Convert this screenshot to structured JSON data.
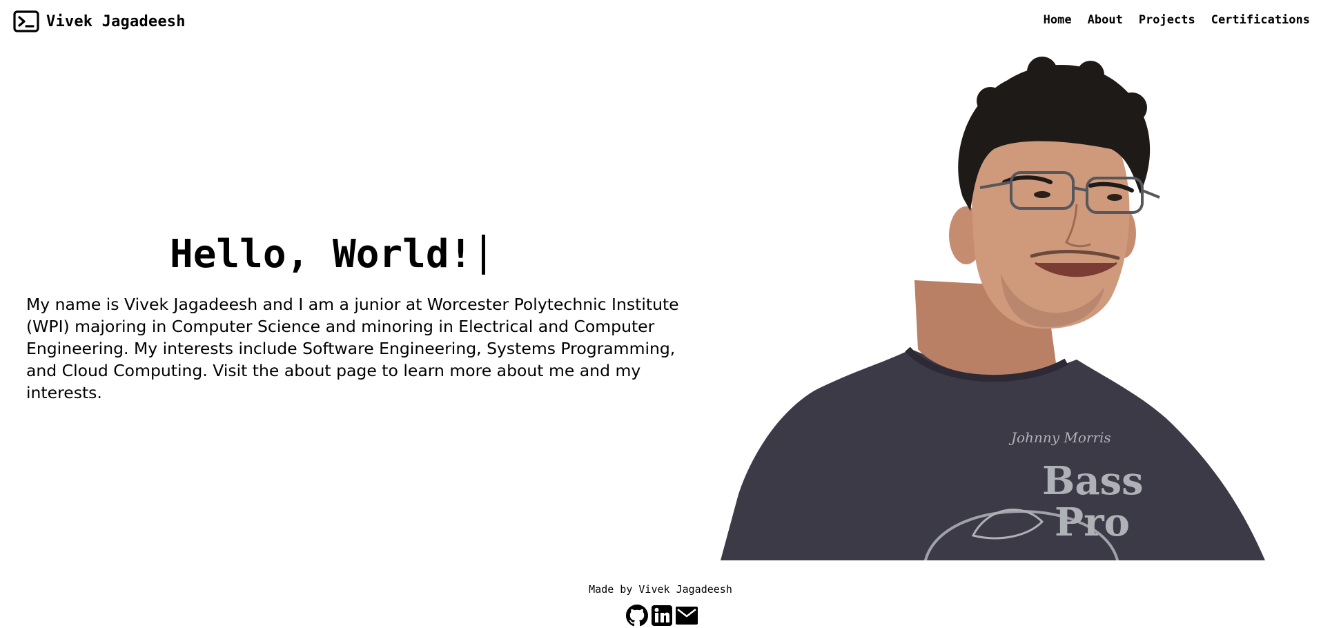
{
  "header": {
    "brand_name": "Vivek Jagadeesh",
    "brand_icon": "terminal-icon",
    "nav": [
      {
        "label": "Home"
      },
      {
        "label": "About"
      },
      {
        "label": "Projects"
      },
      {
        "label": "Certifications"
      }
    ]
  },
  "hero": {
    "title": "Hello, World!",
    "intro": "My name is Vivek Jagadeesh and I am a junior at Worcester Polytechnic Institute (WPI) majoring in Computer Science and minoring in Electrical and Computer Engineering. My interests include Software Engineering, Systems Programming, and Cloud Computing. Visit the about page to learn more about me and my interests."
  },
  "portrait": {
    "shirt_color": "#3d3a48",
    "skin_color": "#c99478",
    "hair_color": "#1e1a17",
    "shirt_text_line1": "Bass",
    "shirt_text_line2": "Pro"
  },
  "footer": {
    "credit": "Made by Vivek Jagadeesh",
    "icons": [
      "github-icon",
      "linkedin-icon",
      "mail-icon"
    ]
  }
}
